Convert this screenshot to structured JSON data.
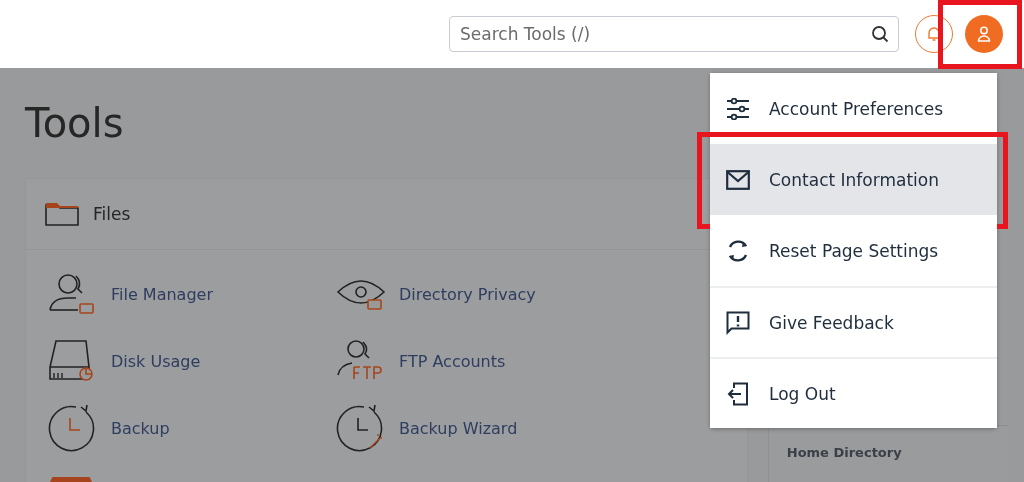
{
  "top_bar": {
    "search": {
      "placeholder": "Search Tools (/)"
    },
    "user_button": {
      "highlighted": true
    }
  },
  "page": {
    "title": "Tools"
  },
  "files_card": {
    "title": "Files",
    "tools": [
      {
        "label": "File Manager"
      },
      {
        "label": "Directory Privacy"
      },
      {
        "label": "Disk Usage"
      },
      {
        "label": "FTP Accounts"
      },
      {
        "label": "Backup"
      },
      {
        "label": "Backup Wizard"
      }
    ]
  },
  "sidebar": {
    "label": "Home Directory"
  },
  "user_menu": {
    "items": [
      {
        "label": "Account Preferences",
        "selected": false,
        "highlighted": false,
        "divider_above": false
      },
      {
        "label": "Contact Information",
        "selected": true,
        "highlighted": true,
        "divider_above": false
      },
      {
        "label": "Reset Page Settings",
        "selected": false,
        "highlighted": false,
        "divider_above": false
      },
      {
        "label": "Give Feedback",
        "selected": false,
        "highlighted": false,
        "divider_above": true
      },
      {
        "label": "Log Out",
        "selected": false,
        "highlighted": false,
        "divider_above": true
      }
    ]
  }
}
